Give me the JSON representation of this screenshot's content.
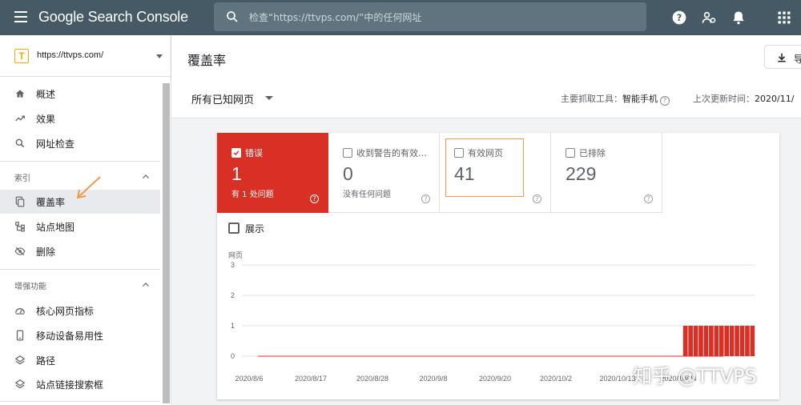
{
  "topbar": {
    "brand": "Google Search Console",
    "search_placeholder": "检查“https://ttvps.com/”中的任何网址"
  },
  "sidebar": {
    "property": {
      "badge": "T",
      "url": "https://ttvps.com/"
    },
    "items": [
      {
        "label": "概述",
        "icon": "home-icon"
      },
      {
        "label": "效果",
        "icon": "trending-icon"
      },
      {
        "label": "网址检查",
        "icon": "search-icon"
      }
    ],
    "sections": [
      {
        "title": "索引",
        "items": [
          {
            "label": "覆盖率",
            "icon": "coverage-icon",
            "active": true
          },
          {
            "label": "站点地图",
            "icon": "sitemap-icon"
          },
          {
            "label": "删除",
            "icon": "removal-icon"
          }
        ]
      },
      {
        "title": "增强功能",
        "items": [
          {
            "label": "核心网页指标",
            "icon": "gauge-icon"
          },
          {
            "label": "移动设备易用性",
            "icon": "phone-icon"
          },
          {
            "label": "路径",
            "icon": "layers-icon"
          },
          {
            "label": "站点链接搜索框",
            "icon": "layers-icon"
          }
        ]
      }
    ]
  },
  "header": {
    "title": "覆盖率",
    "export_label": "导"
  },
  "filter": {
    "dropdown": "所有已知网页",
    "crawler_label": "主要抓取工具：",
    "crawler_value": "智能手机",
    "updated_label": "上次更新时间：",
    "updated_value": "2020/11/"
  },
  "tiles": [
    {
      "label": "错误",
      "value": "1",
      "sub": "有 1 处问题",
      "checked": true
    },
    {
      "label": "收到警告的有效…",
      "value": "0",
      "sub": "没有任何问题",
      "checked": false
    },
    {
      "label": "有效网页",
      "value": "41",
      "sub": "",
      "checked": false
    },
    {
      "label": "已排除",
      "value": "229",
      "sub": "",
      "checked": false
    }
  ],
  "show_label": "展示",
  "colors": {
    "error": "#d93025",
    "topbar": "#455a64"
  },
  "chart_data": {
    "type": "bar",
    "ylabel": "网页",
    "ylim": [
      0,
      3
    ],
    "yticks": [
      "0",
      "1",
      "2",
      "3"
    ],
    "xticks": [
      "2020/8/6",
      "2020/8/17",
      "2020/8/28",
      "2020/9/8",
      "2020/9/20",
      "2020/10/2",
      "2020/10/13",
      "2020/10/24"
    ],
    "series": [
      {
        "values": [
          0,
          0,
          0,
          0,
          0,
          0,
          0,
          0,
          0,
          0,
          0,
          0,
          0,
          0,
          0,
          0,
          0,
          0,
          0,
          0,
          0,
          0,
          0,
          0,
          0,
          0,
          0,
          0,
          0,
          0,
          0,
          0,
          0,
          0,
          0,
          0,
          0,
          0,
          0,
          0,
          0,
          0,
          0,
          0,
          0,
          0,
          0,
          0,
          0,
          0,
          0,
          0,
          0,
          0,
          0,
          0,
          0,
          0,
          0,
          0,
          0,
          0,
          0,
          0,
          0,
          0,
          0,
          0,
          0,
          0,
          0,
          0,
          0,
          0,
          0,
          0,
          0,
          0,
          0,
          0,
          0,
          0,
          1,
          1,
          1,
          1,
          1,
          1,
          1,
          1,
          1,
          1,
          1,
          1,
          1,
          1
        ]
      }
    ]
  },
  "watermark": "知乎 @TTVPS"
}
